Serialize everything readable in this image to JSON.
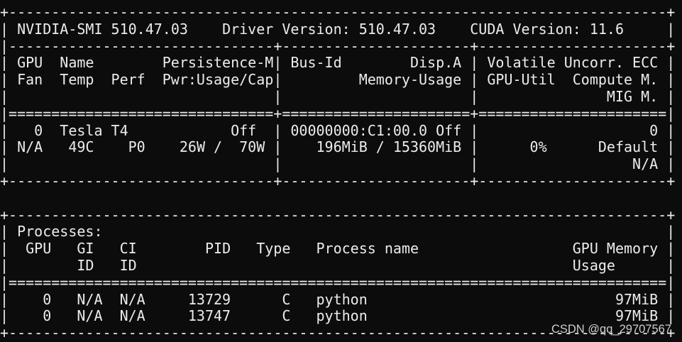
{
  "theme": {
    "background": "#0c0c0c",
    "foreground": "#ececec",
    "watermark": "#cfcfcf"
  },
  "frame": {
    "top_rule": "+-----------------------------------------------------------------------------+",
    "header_rule": "|-------------------------------+----------------------+----------------------+",
    "gpu_double_rule": "|===============================+======================+======================|",
    "gpu_bottom_rule": "+-------------------------------+----------------------+----------------------+",
    "proc_double_rule": "|=============================================================================|",
    "vbar": "|"
  },
  "header": {
    "smi_label": "NVIDIA-SMI",
    "smi_version": "510.47.03",
    "driver_label": "Driver Version:",
    "driver_version": "510.47.03",
    "cuda_label": "CUDA Version:",
    "cuda_version": "11.6"
  },
  "gpu_table": {
    "columns": {
      "gpu": "GPU",
      "name": "Name",
      "persistence": "Persistence-M",
      "bus_id": "Bus-Id",
      "disp": "Disp.A",
      "volatile_ecc": "Volatile Uncorr. ECC",
      "fan": "Fan",
      "temp": "Temp",
      "perf": "Perf",
      "power": "Pwr:Usage/Cap",
      "memory_usage": "Memory-Usage",
      "gpu_util": "GPU-Util",
      "compute_mode": "Compute M.",
      "mig_mode": "MIG M."
    },
    "gpus": [
      {
        "index": "0",
        "name": "Tesla T4",
        "persistence": "Off",
        "bus_id": "00000000:C1:00.0",
        "disp": "Off",
        "ecc": "0",
        "fan": "N/A",
        "temp": "49C",
        "perf": "P0",
        "power_usage": "26W",
        "power_sep": "/",
        "power_cap": "70W",
        "memory_used": "196MiB",
        "memory_sep": "/",
        "memory_total": "15360MiB",
        "gpu_util": "0%",
        "compute_mode": "Default",
        "mig_mode": "N/A"
      }
    ]
  },
  "processes": {
    "title": "Processes:",
    "columns": {
      "gpu": "GPU",
      "gi": "GI",
      "ci": "CI",
      "pid": "PID",
      "type": "Type",
      "process_name": "Process name",
      "gpu_memory": "GPU Memory",
      "gi_sub": "ID",
      "ci_sub": "ID",
      "gpu_memory_sub": "Usage"
    },
    "rows": [
      {
        "gpu": "0",
        "gi": "N/A",
        "ci": "N/A",
        "pid": "13729",
        "type": "C",
        "process_name": "python",
        "gpu_memory": "97MiB"
      },
      {
        "gpu": "0",
        "gi": "N/A",
        "ci": "N/A",
        "pid": "13747",
        "type": "C",
        "process_name": "python",
        "gpu_memory": "97MiB"
      }
    ]
  },
  "watermark": {
    "text": "CSDN @qq_29707567"
  }
}
